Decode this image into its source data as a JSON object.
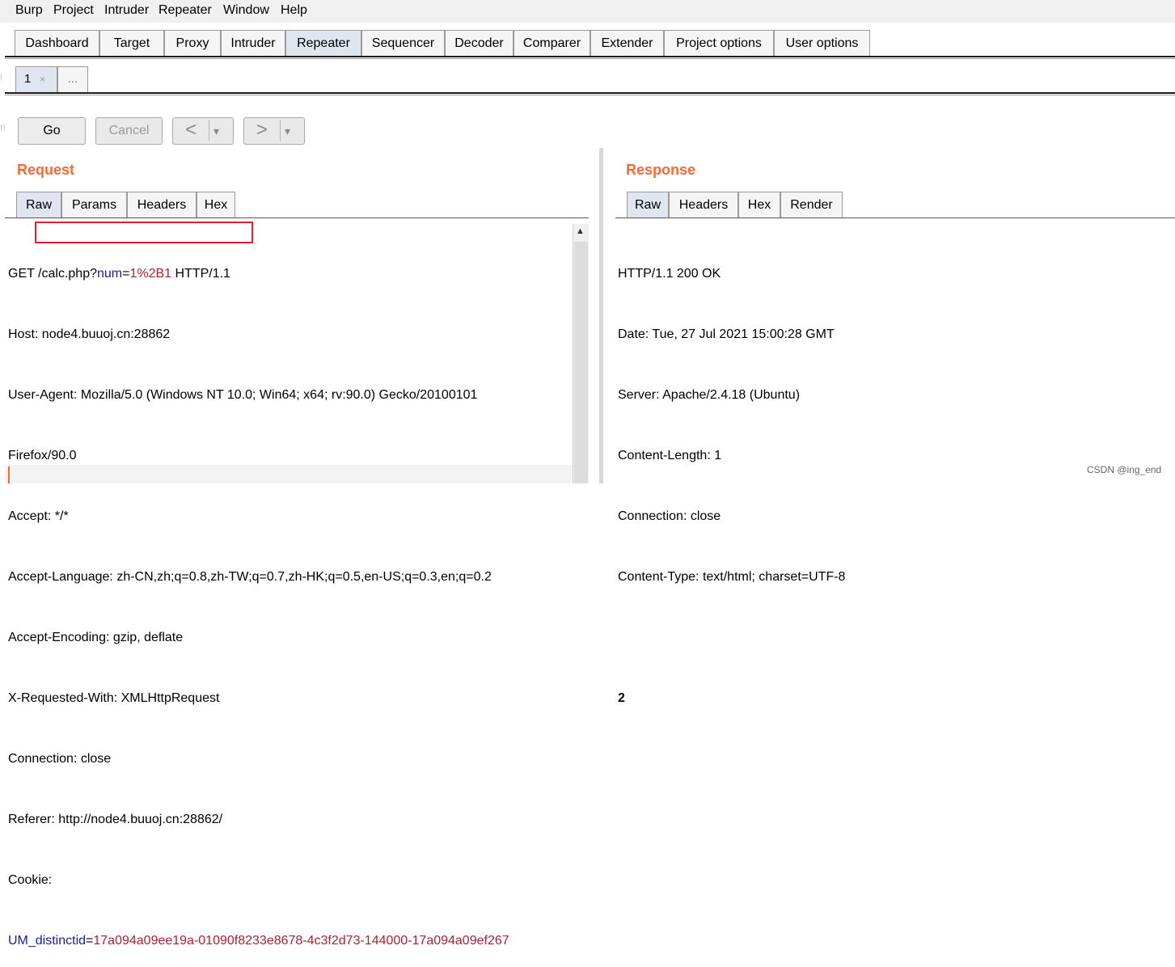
{
  "menubar": {
    "items": [
      "Burp",
      "Project",
      "Intruder",
      "Repeater",
      "Window",
      "Help"
    ]
  },
  "main_tabs": [
    "Dashboard",
    "Target",
    "Proxy",
    "Intruder",
    "Repeater",
    "Sequencer",
    "Decoder",
    "Comparer",
    "Extender",
    "Project options",
    "User options"
  ],
  "active_main_tab": "Repeater",
  "repeater_tabs": {
    "tab1_label": "1",
    "tab1_close": "×",
    "more_label": "..."
  },
  "toolbar": {
    "go_label": "Go",
    "cancel_label": "Cancel",
    "back_label": "<",
    "forward_label": ">",
    "dropdown": "▾"
  },
  "request": {
    "title": "Request",
    "tabs": [
      "Raw",
      "Params",
      "Headers",
      "Hex"
    ],
    "line1": {
      "method": "GET ",
      "path": "/calc.php?",
      "param": "num",
      "eq": "=",
      "value": "1%2B1",
      "proto": " HTTP/1.1"
    },
    "lines": [
      "Host: node4.buuoj.cn:28862",
      "User-Agent: Mozilla/5.0 (Windows NT 10.0; Win64; x64; rv:90.0) Gecko/20100101",
      "Firefox/90.0",
      "Accept: */*",
      "Accept-Language: zh-CN,zh;q=0.8,zh-TW;q=0.7,zh-HK;q=0.5,en-US;q=0.3,en;q=0.2",
      "Accept-Encoding: gzip, deflate",
      "X-Requested-With: XMLHttpRequest",
      "Connection: close",
      "Referer: http://node4.buuoj.cn:28862/",
      "Cookie:"
    ],
    "cookie_line": {
      "name": "UM_distinctid",
      "eq": "=",
      "value": "17a094a09ee19a-01090f8233e8678-4c3f2d73-144000-17a094a09ef267"
    }
  },
  "response": {
    "title": "Response",
    "tabs": [
      "Raw",
      "Headers",
      "Hex",
      "Render"
    ],
    "lines": [
      "HTTP/1.1 200 OK",
      "Date: Tue, 27 Jul 2021 15:00:28 GMT",
      "Server: Apache/2.4.18 (Ubuntu)",
      "Content-Length: 1",
      "Connection: close",
      "Content-Type: text/html; charset=UTF-8"
    ],
    "body": "2"
  },
  "watermark": "CSDN @ing_end",
  "colors": {
    "accent": "#ff6633",
    "highlight": "#e0202e",
    "param": "#1a1aa6",
    "value": "#b0202e"
  }
}
